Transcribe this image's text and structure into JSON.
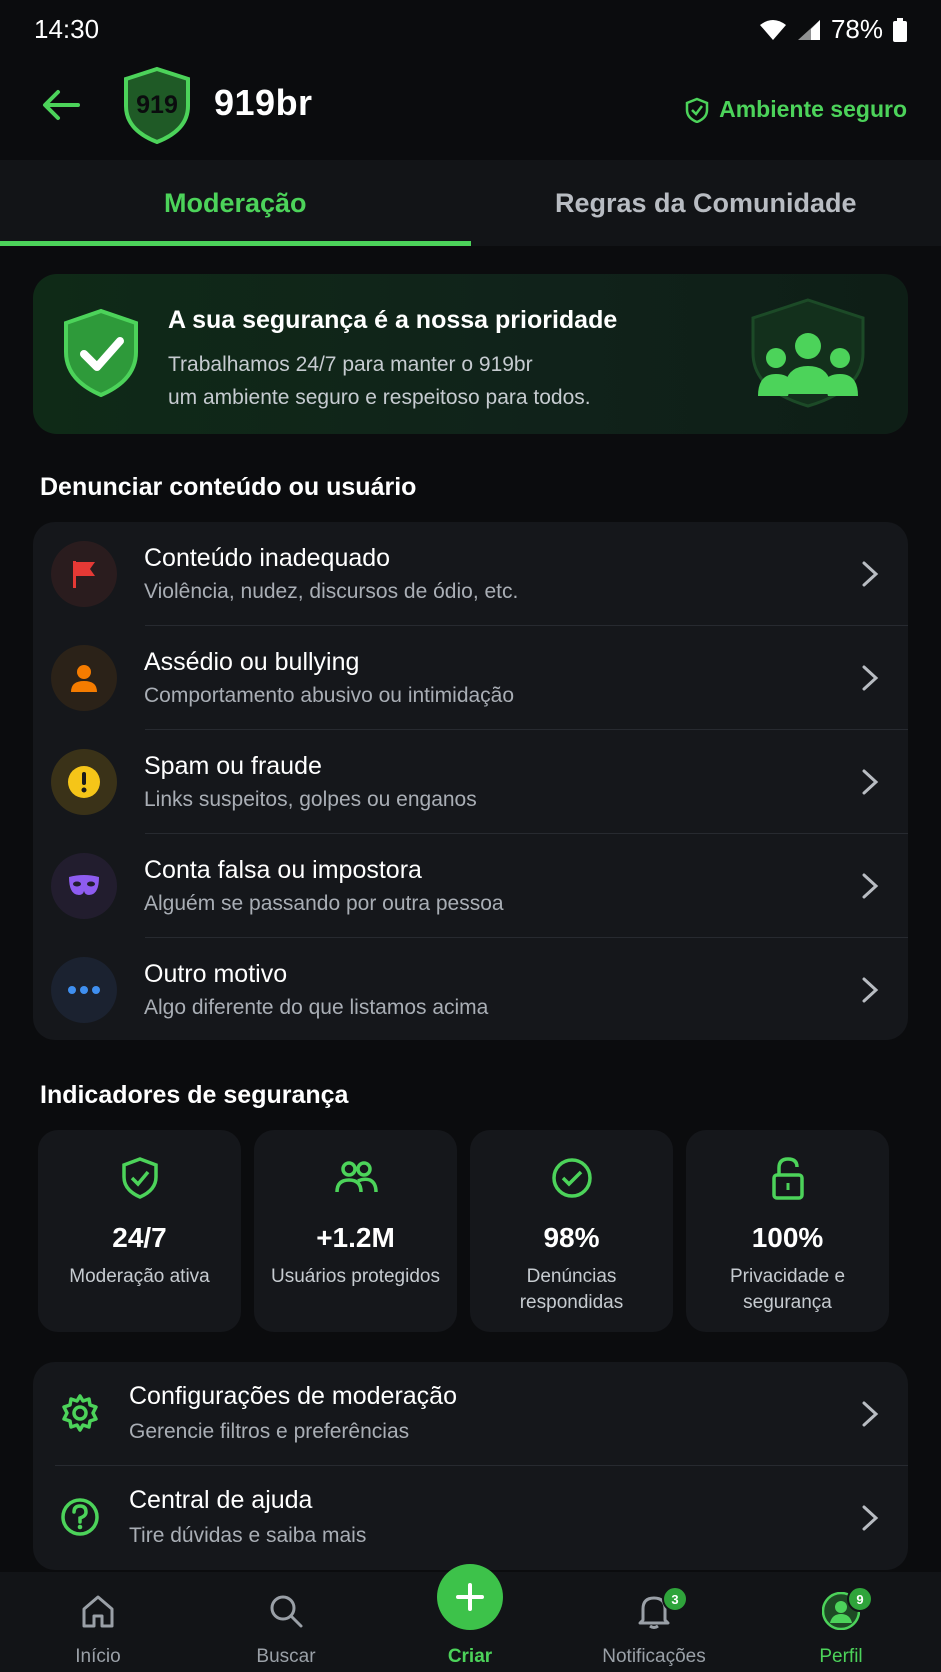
{
  "status_bar": {
    "time": "14:30",
    "battery": "78%"
  },
  "header": {
    "logo_text": "919",
    "title": "919br",
    "safe_label": "Ambiente seguro"
  },
  "tabs": [
    {
      "label": "Moderação",
      "active": true
    },
    {
      "label": "Regras da Comunidade",
      "active": false
    }
  ],
  "banner": {
    "title": "A sua segurança é a nossa prioridade",
    "line1": "Trabalhamos 24/7 para manter o 919br",
    "line2": "um ambiente seguro e respeitoso para todos."
  },
  "report": {
    "section_title": "Denunciar conteúdo ou usuário",
    "items": [
      {
        "title": "Conteúdo inadequado",
        "subtitle": "Violência, nudez, discursos de ódio, etc.",
        "icon": "flag-icon",
        "color": "#e53935"
      },
      {
        "title": "Assédio ou bullying",
        "subtitle": "Comportamento abusivo ou intimidação",
        "icon": "person-icon",
        "color": "#f57c00"
      },
      {
        "title": "Spam ou fraude",
        "subtitle": "Links suspeitos, golpes ou enganos",
        "icon": "exclamation-icon",
        "color": "#f5c518"
      },
      {
        "title": "Conta falsa ou impostora",
        "subtitle": "Alguém se passando por outra pessoa",
        "icon": "mask-icon",
        "color": "#8e5cf0"
      },
      {
        "title": "Outro motivo",
        "subtitle": "Algo diferente do que listamos acima",
        "icon": "more-dots-icon",
        "color": "#3f8ff0"
      }
    ]
  },
  "indicators": {
    "section_title": "Indicadores de segurança",
    "items": [
      {
        "value": "24/7",
        "label": "Moderação ativa",
        "icon": "shield-check-icon"
      },
      {
        "value": "+1.2M",
        "label": "Usuários protegidos",
        "icon": "users-icon"
      },
      {
        "value": "98%",
        "label": "Denúncias respondidas",
        "icon": "check-circle-icon"
      },
      {
        "value": "100%",
        "label": "Privacidade e segurança",
        "icon": "lock-icon"
      }
    ]
  },
  "settings": [
    {
      "title": "Configurações de moderação",
      "subtitle": "Gerencie filtros e preferências",
      "icon": "gear-icon"
    },
    {
      "title": "Central de ajuda",
      "subtitle": "Tire dúvidas e saiba mais",
      "icon": "help-circle-icon"
    }
  ],
  "nav": {
    "home": "Início",
    "search": "Buscar",
    "create": "Criar",
    "notifications": "Notificações",
    "notifications_badge": "3",
    "profile": "Perfil",
    "profile_badge": "9"
  },
  "colors": {
    "accent": "#4cd35a",
    "background": "#0b0c0e",
    "card": "#15171b"
  }
}
